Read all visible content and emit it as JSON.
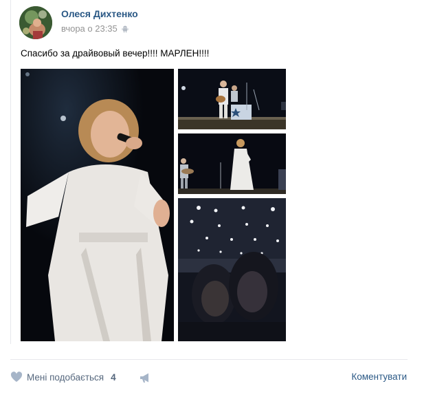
{
  "post": {
    "author": "Олеся Дихтенко",
    "time": "вчора о 23:35",
    "text": "Спасибо за драйвовый вечер!!!! МАРЛЕН!!!!"
  },
  "footer": {
    "like_label": "Мені подобається",
    "like_count": "4",
    "comment_label": "Коментувати"
  },
  "colors": {
    "link": "#2a5885",
    "meta": "#939393",
    "action": "#55677d",
    "icon": "#a6b5c8"
  },
  "icons": [
    "android-icon",
    "heart-icon",
    "megaphone-icon"
  ]
}
